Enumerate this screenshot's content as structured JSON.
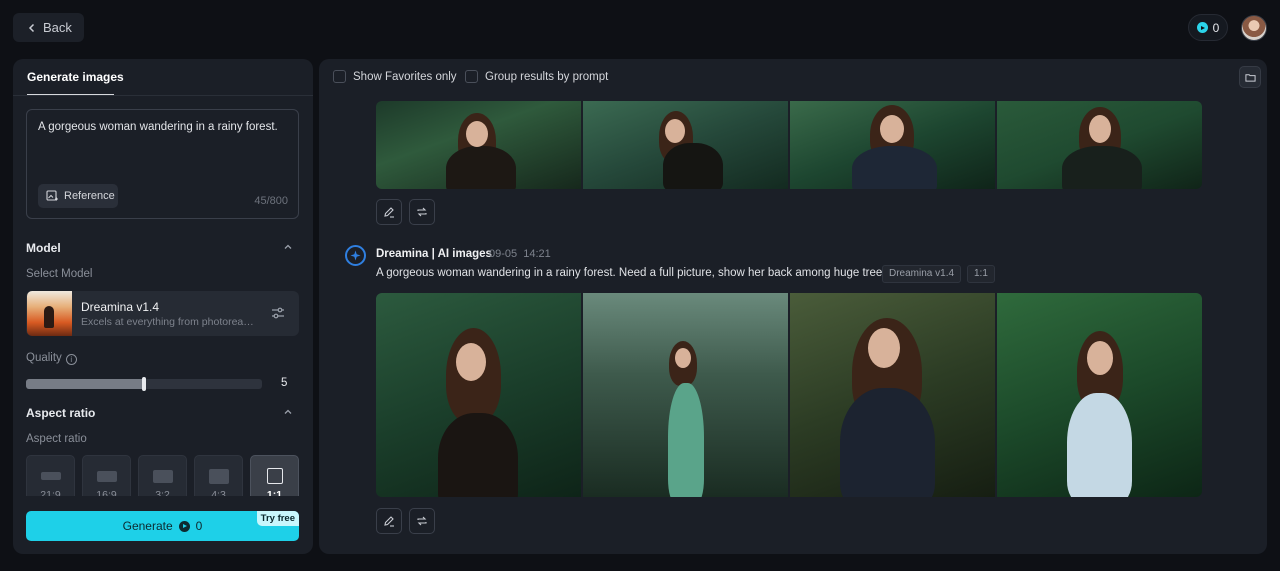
{
  "topbar": {
    "back_label": "Back",
    "credits": "0"
  },
  "left_panel": {
    "tab_label": "Generate images",
    "prompt_text": "A gorgeous woman wandering in a rainy forest.",
    "reference_label": "Reference",
    "char_count": "45/800",
    "model_section": {
      "title": "Model",
      "select_label": "Select Model",
      "model_name": "Dreamina v1.4",
      "model_desc": "Excels at everything from photorealism to painterly styles"
    },
    "quality": {
      "label": "Quality",
      "value": "5",
      "fraction": 0.5
    },
    "aspect_section": {
      "title": "Aspect ratio",
      "sub_label": "Aspect ratio",
      "ratios": [
        {
          "label": "21:9",
          "active": false
        },
        {
          "label": "16:9",
          "active": false
        },
        {
          "label": "3:2",
          "active": false
        },
        {
          "label": "4:3",
          "active": false
        },
        {
          "label": "1:1",
          "active": true
        }
      ]
    },
    "generate": {
      "label": "Generate",
      "cost": "0",
      "badge": "Try free"
    }
  },
  "right_panel": {
    "show_favorites_label": "Show Favorites only",
    "group_by_prompt_label": "Group results by prompt",
    "generation": {
      "author": "Dreamina | AI images",
      "date": "09-05",
      "time": "14:21",
      "prompt": "A gorgeous woman wandering in a rainy forest. Need a full picture, show her back among huge trees",
      "model_tag": "Dreamina v1.4",
      "ratio_tag": "1:1"
    }
  },
  "colors": {
    "accent": "#1ed0e8",
    "panel": "#1b1f27",
    "background": "#0e1015",
    "logo_blue": "#2f7fe0"
  }
}
